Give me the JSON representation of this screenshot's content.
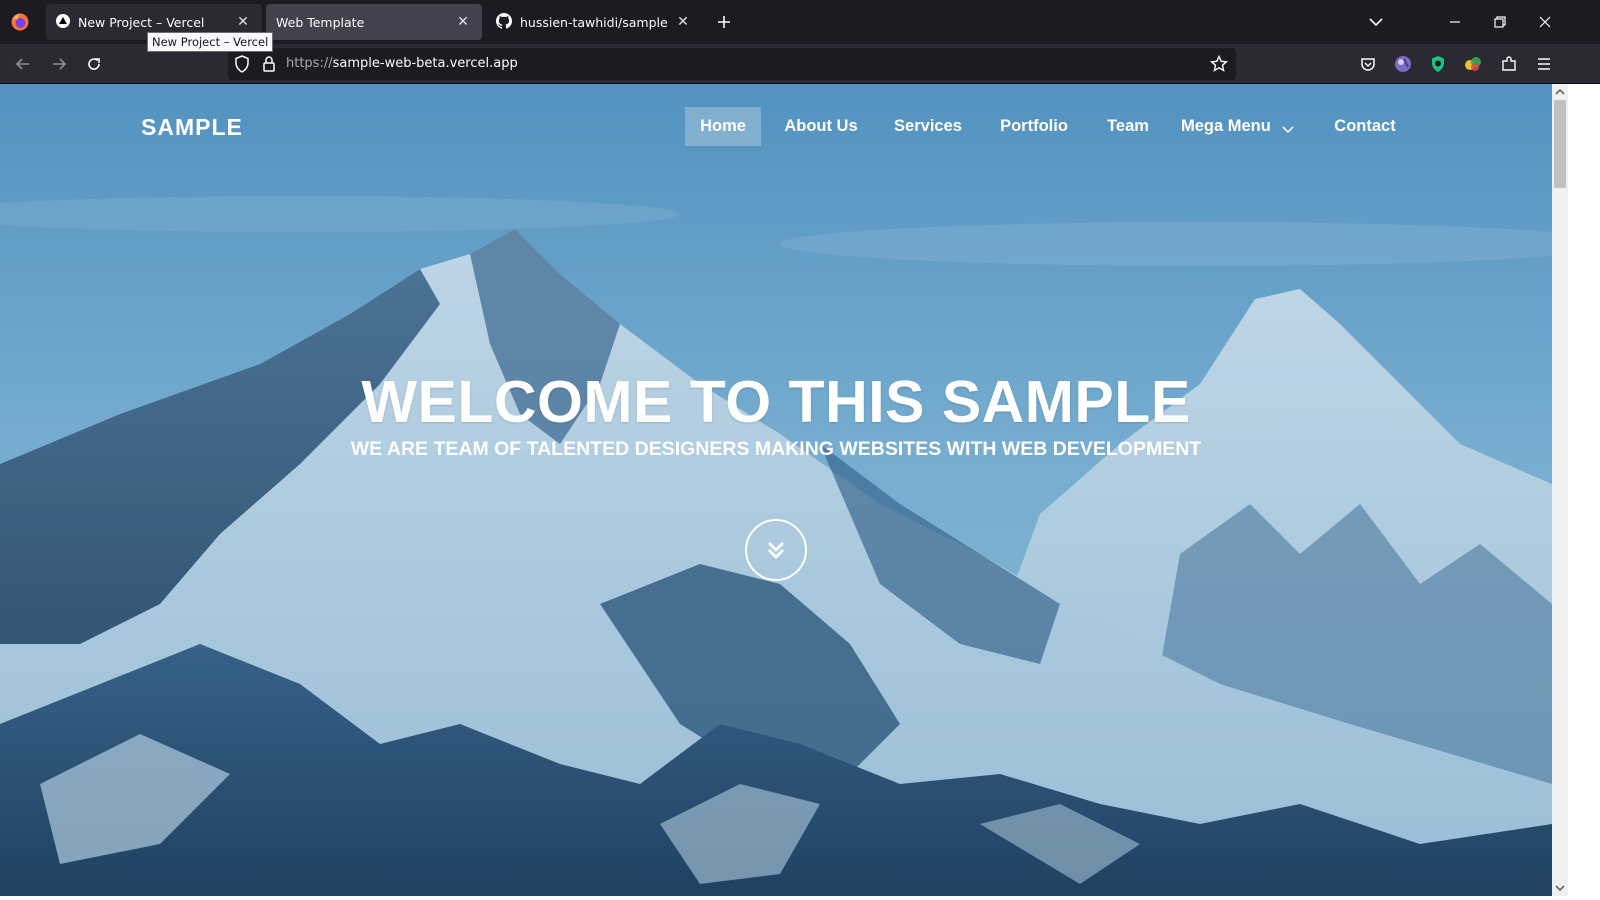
{
  "browser": {
    "tabs": [
      {
        "title": "New Project – Vercel",
        "icon": "vercel-triangle-icon"
      },
      {
        "title": "Web Template",
        "icon": "none"
      },
      {
        "title": "hussien-tawhidi/sample",
        "icon": "github-icon"
      }
    ],
    "tooltip": "New Project – Vercel",
    "url": {
      "scheme": "https://",
      "host": "sample-web-beta.vercel.app"
    }
  },
  "site": {
    "logo": "SAMPLE",
    "nav": [
      {
        "label": "Home",
        "active": true
      },
      {
        "label": "About Us"
      },
      {
        "label": "Services"
      },
      {
        "label": "Portfolio"
      },
      {
        "label": "Team"
      },
      {
        "label": "Mega Menu"
      },
      {
        "label": "Contact"
      }
    ],
    "hero": {
      "title": "WELCOME TO THIS SAMPLE",
      "subtitle": "WE ARE TEAM OF TALENTED DESIGNERS MAKING WEBSITES WITH WEB DEVELOPMENT"
    }
  },
  "colors": {
    "chrome_bg": "#1c1b22",
    "toolbar_bg": "#2b2a33",
    "active_tab": "#42414d",
    "sky": "#6fa8cf",
    "snow": "#dceaf4",
    "rock": "#2c4a68"
  }
}
